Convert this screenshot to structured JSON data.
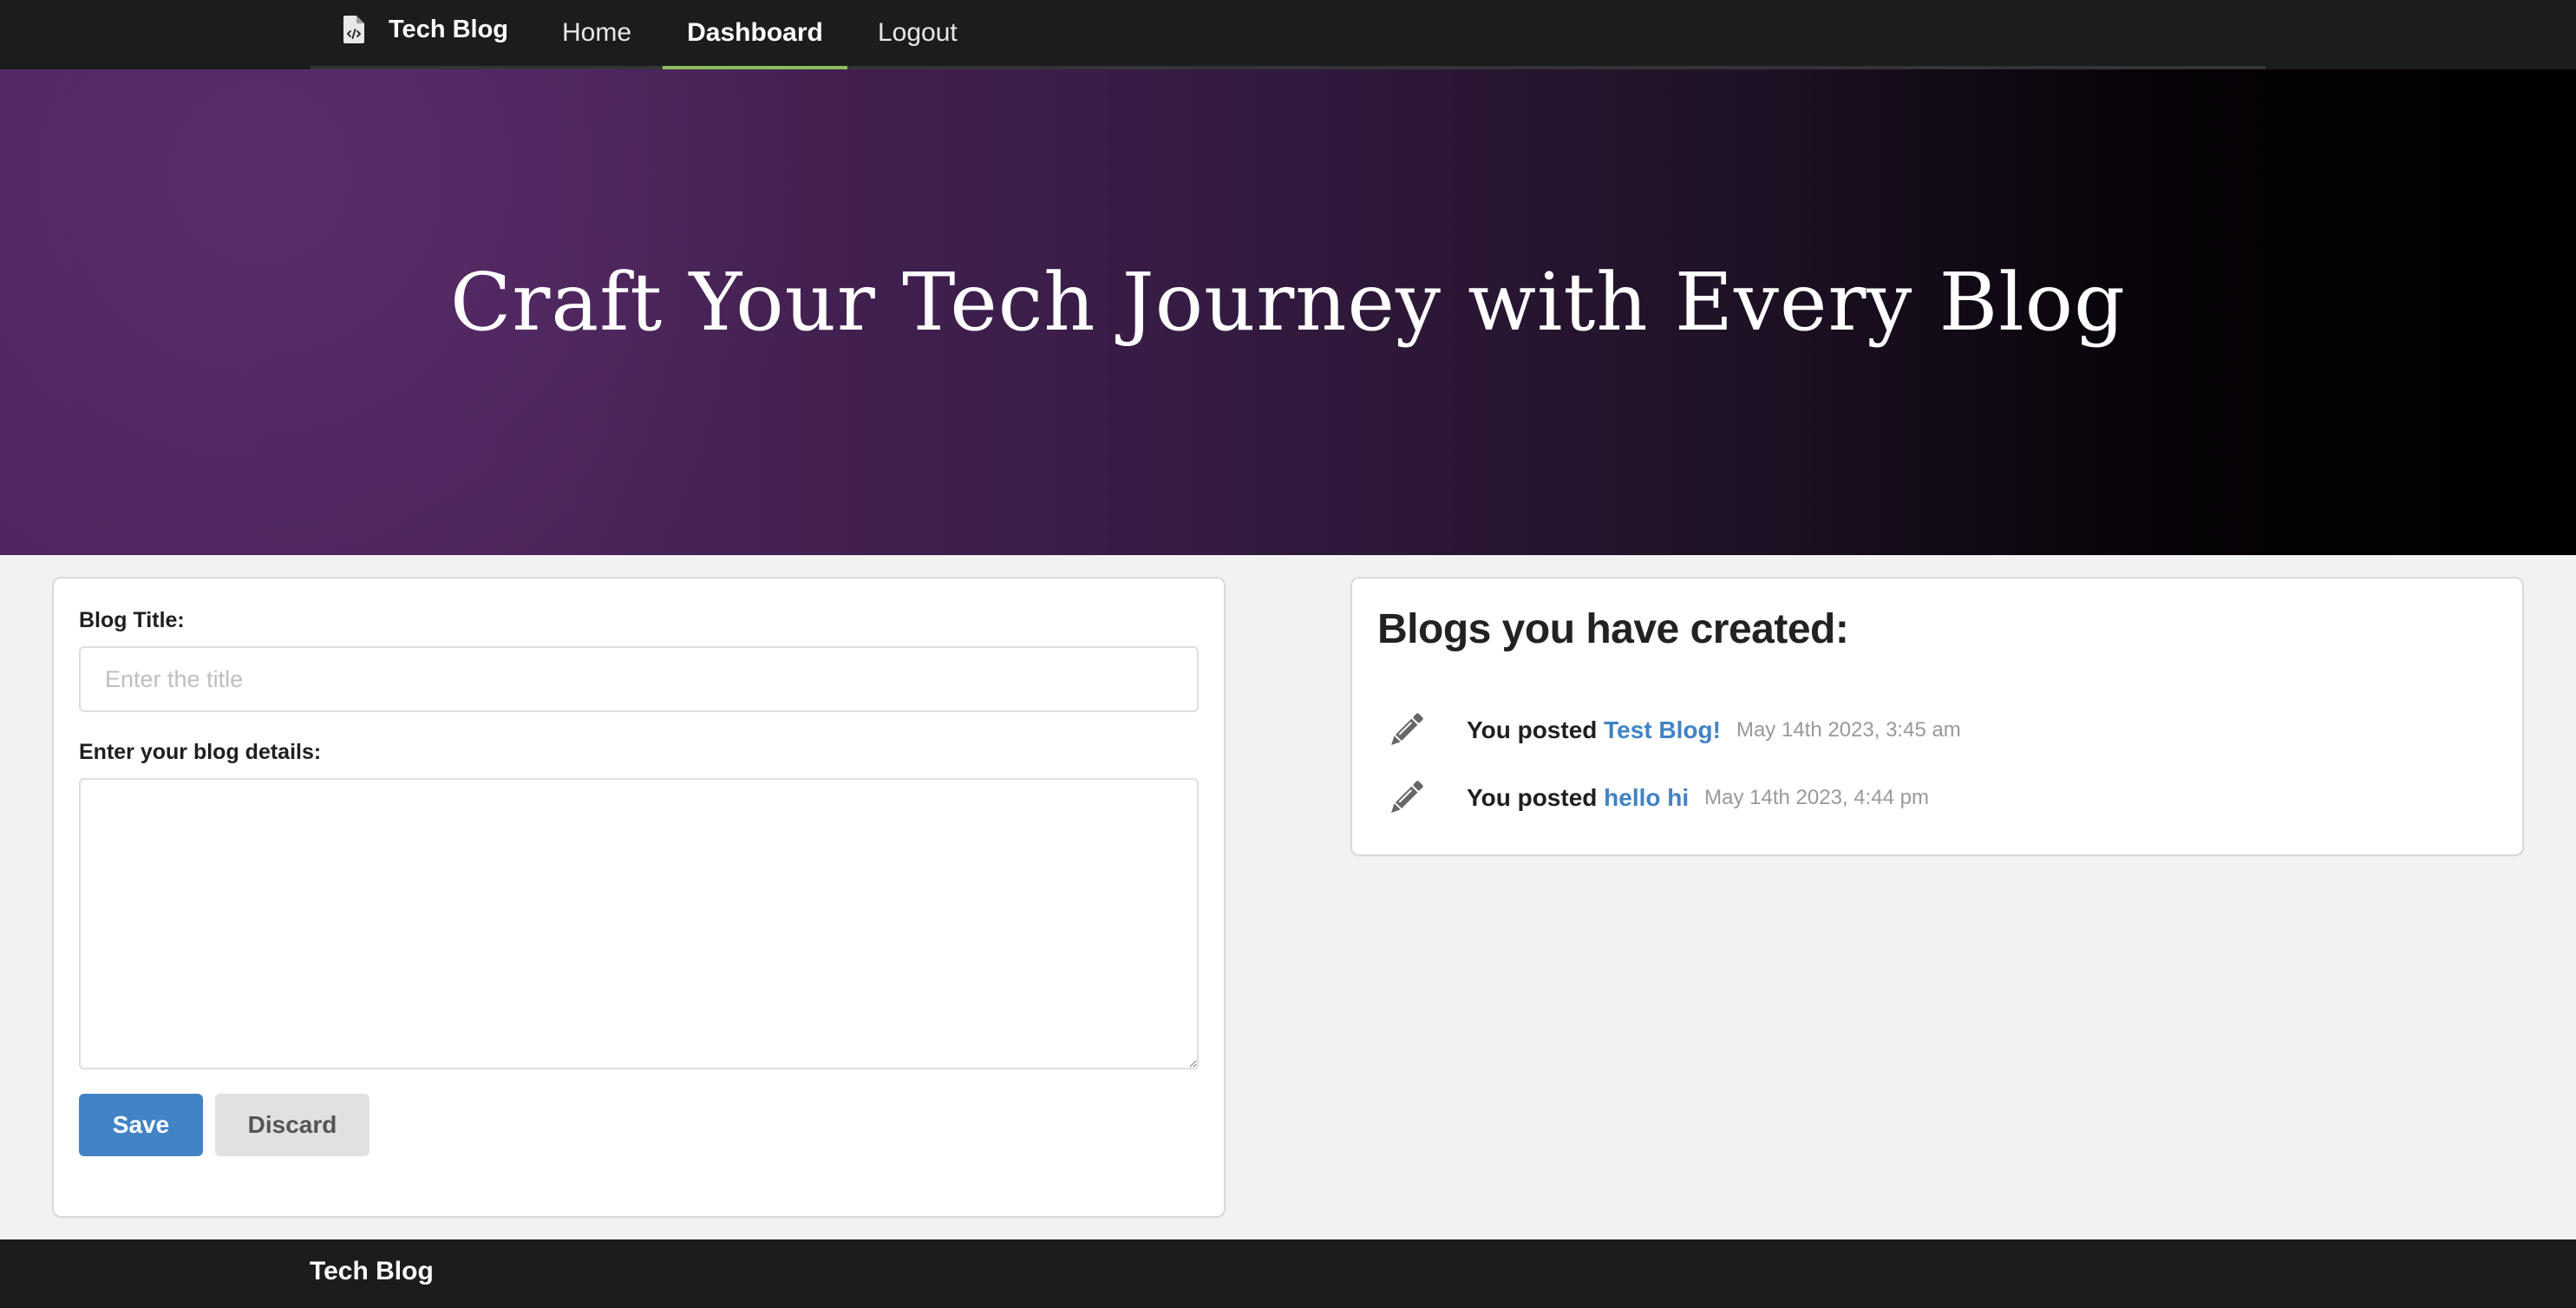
{
  "nav": {
    "brand": "Tech Blog",
    "brand_icon": "file-code-icon",
    "items": [
      {
        "label": "Home",
        "active": false
      },
      {
        "label": "Dashboard",
        "active": true
      },
      {
        "label": "Logout",
        "active": false
      }
    ],
    "active_color": "#8cbd5d"
  },
  "hero": {
    "title": "Craft Your Tech Journey with Every Blog"
  },
  "form": {
    "title_label": "Blog Title:",
    "title_placeholder": "Enter the title",
    "title_value": "",
    "details_label": "Enter your blog details:",
    "details_value": "",
    "save_label": "Save",
    "discard_label": "Discard",
    "save_color": "#4183c4"
  },
  "blogs": {
    "heading": "Blogs you have created:",
    "items": [
      {
        "prefix": "You posted",
        "title": "Test Blog!",
        "date": "May 14th 2023, 3:45 am",
        "icon": "pencil-icon"
      },
      {
        "prefix": "You posted",
        "title": "hello hi",
        "date": "May 14th 2023, 4:44 pm",
        "icon": "pencil-icon"
      }
    ]
  },
  "footer": {
    "brand": "Tech Blog"
  }
}
